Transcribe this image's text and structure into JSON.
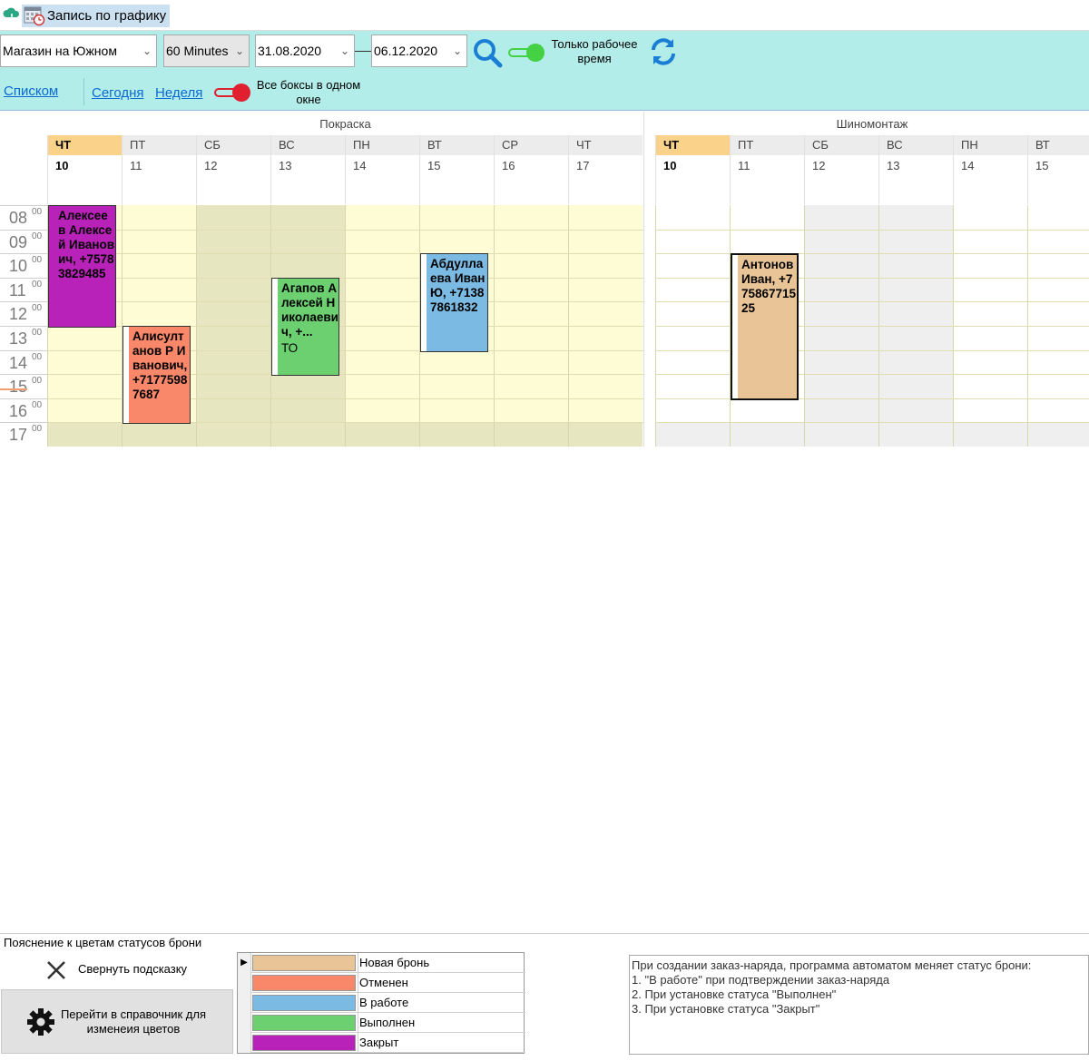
{
  "window": {
    "tab_title": "Запись по графику"
  },
  "toolbar": {
    "store": "Магазин на Южном",
    "interval": "60 Minutes",
    "date_from": "31.08.2020",
    "date_to": "06.12.2020",
    "working_time_label_line1": "Только рабочее",
    "working_time_label_line2": "время",
    "working_time_on": true,
    "list_link": "Списком",
    "today_link": "Сегодня",
    "week_link": "Неделя",
    "all_boxes_label_line1": "Все боксы в одном",
    "all_boxes_label_line2": "окне",
    "all_boxes_on": false
  },
  "calendar": {
    "hours": [
      {
        "h": "08",
        "m": "00"
      },
      {
        "h": "09",
        "m": "00"
      },
      {
        "h": "10",
        "m": "00"
      },
      {
        "h": "11",
        "m": "00"
      },
      {
        "h": "12",
        "m": "00"
      },
      {
        "h": "13",
        "m": "00"
      },
      {
        "h": "14",
        "m": "00"
      },
      {
        "h": "15",
        "m": "00"
      },
      {
        "h": "16",
        "m": "00"
      },
      {
        "h": "17",
        "m": "00"
      }
    ],
    "resources": [
      {
        "name": "Покраска",
        "days": [
          {
            "dow": "ЧТ",
            "num": "10",
            "today": true
          },
          {
            "dow": "ПТ",
            "num": "11"
          },
          {
            "dow": "СБ",
            "num": "12",
            "weekend": true
          },
          {
            "dow": "ВС",
            "num": "13",
            "weekend": true
          },
          {
            "dow": "ПН",
            "num": "14"
          },
          {
            "dow": "ВТ",
            "num": "15"
          },
          {
            "dow": "СР",
            "num": "16"
          },
          {
            "dow": "ЧТ",
            "num": "17"
          }
        ],
        "events": [
          {
            "text": "Алексеев Алексей Иванович, +75783829485",
            "sub": "",
            "day": 0,
            "start": 8,
            "end": 13,
            "color": "#b822b8",
            "stripe": false
          },
          {
            "text": "Алисултанов Р Иванович, +71775987687",
            "sub": "",
            "day": 1,
            "start": 13,
            "end": 17,
            "color": "#f9876a",
            "stripe": true
          },
          {
            "text": "Агапов Алексей Николаевич, +...",
            "sub": "ТО",
            "day": 3,
            "start": 11,
            "end": 15,
            "color": "#6cd070",
            "stripe": true
          },
          {
            "text": "Абдуллаева Иван Ю, +71387861832",
            "sub": "",
            "day": 5,
            "start": 10,
            "end": 14,
            "color": "#7bbbe3",
            "stripe": true
          }
        ]
      },
      {
        "name": "Шиномонтаж",
        "days": [
          {
            "dow": "ЧТ",
            "num": "10",
            "today": true
          },
          {
            "dow": "ПТ",
            "num": "11"
          },
          {
            "dow": "СБ",
            "num": "12",
            "weekend": true
          },
          {
            "dow": "ВС",
            "num": "13",
            "weekend": true
          },
          {
            "dow": "ПН",
            "num": "14"
          },
          {
            "dow": "ВТ",
            "num": "15"
          }
        ],
        "events": [
          {
            "text": "Антонов Иван, +77586771525",
            "sub": "",
            "day": 1,
            "start": 10,
            "end": 16,
            "color": "#e9c497",
            "stripe": true,
            "bold_border": true
          }
        ]
      }
    ]
  },
  "legend": {
    "title": "Пояснение к цветам статусов брони",
    "collapse_label": "Свернуть подсказку",
    "colors_button_line1": "Перейти в справочник для",
    "colors_button_line2": "изменеия цветов",
    "statuses": [
      {
        "name": "Новая бронь",
        "color": "#e9c497"
      },
      {
        "name": "Отменен",
        "color": "#f9876a"
      },
      {
        "name": "В работе",
        "color": "#7bbbe3"
      },
      {
        "name": "Выполнен",
        "color": "#6cd070"
      },
      {
        "name": "Закрыт",
        "color": "#b822b8"
      }
    ],
    "note_lines": [
      "При создании заказ-наряда, программа автоматом меняет статус брони:",
      "1. \"В работе\" при подтверждении заказ-наряда",
      "2. При установке статуса \"Выполнен\"",
      "3. При установке статуса \"Закрыт\""
    ]
  }
}
